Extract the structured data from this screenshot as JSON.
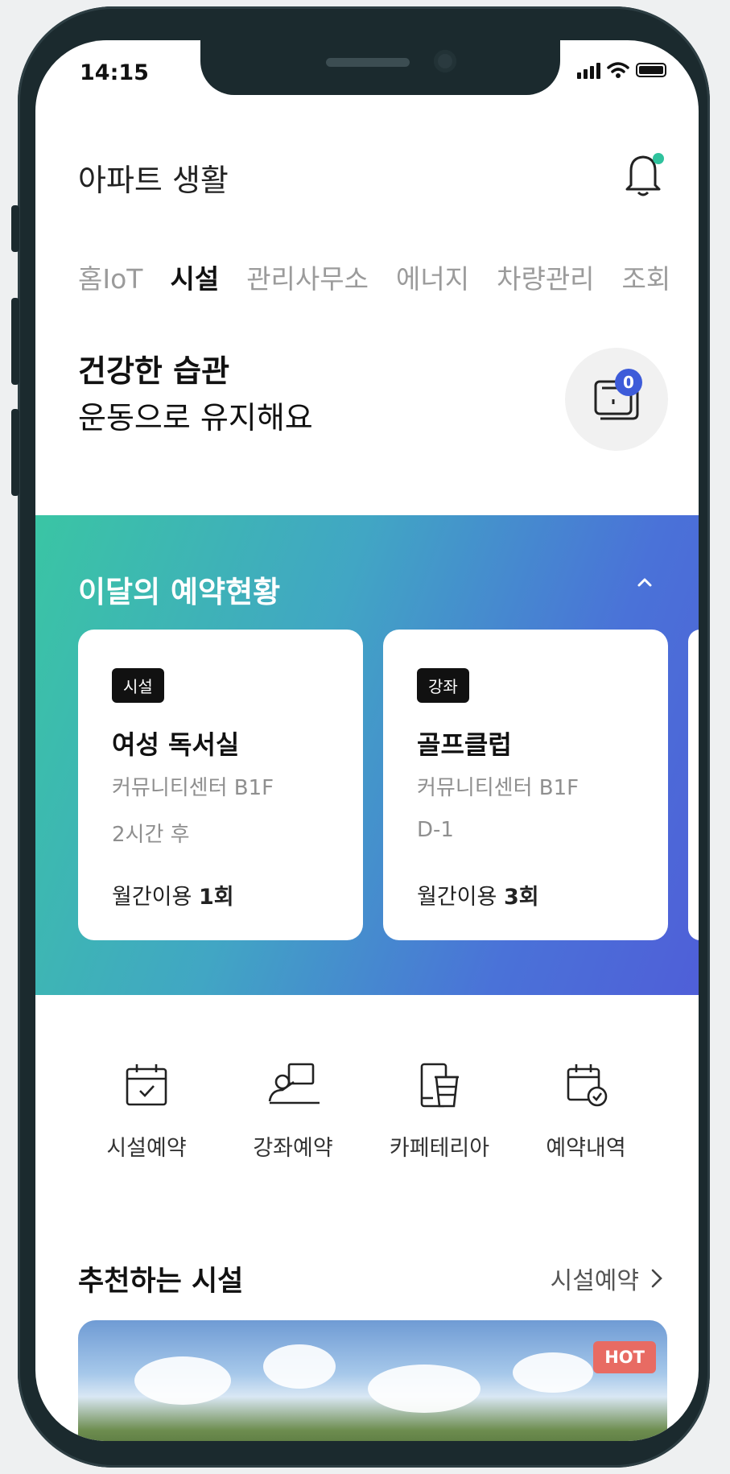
{
  "status_bar": {
    "time": "14:15"
  },
  "header": {
    "title": "아파트 생활"
  },
  "tabs": [
    "홈IoT",
    "시설",
    "관리사무소",
    "에너지",
    "차량관리",
    "조회"
  ],
  "headline": {
    "line1": "건강한 습관",
    "line2": "운동으로 유지해요"
  },
  "ticket": {
    "count": "0"
  },
  "reservations": {
    "title": "이달의 예약현황",
    "cards": [
      {
        "tag": "시설",
        "name": "여성 독서실",
        "location": "커뮤니티센터 B1F",
        "when": "2시간 후",
        "usage_label": "월간이용",
        "usage_count": "1회"
      },
      {
        "tag": "강좌",
        "name": "골프클럽",
        "location": "커뮤니티센터 B1F",
        "when": "D-1",
        "usage_label": "월간이용",
        "usage_count": "3회"
      }
    ]
  },
  "quick_menu": [
    {
      "label": "시설예약",
      "icon": "calendar-check-icon"
    },
    {
      "label": "강좌예약",
      "icon": "lecture-icon"
    },
    {
      "label": "카페테리아",
      "icon": "coffee-cup-icon"
    },
    {
      "label": "예약내역",
      "icon": "calendar-history-icon"
    }
  ],
  "recommend": {
    "title": "추천하는 시설",
    "link": "시설예약",
    "badge": "HOT"
  },
  "colors": {
    "accent_blue": "#3d5bd9",
    "banner_start": "#3ac5a4",
    "banner_end": "#4f5fd8",
    "hot": "#e86b63"
  }
}
